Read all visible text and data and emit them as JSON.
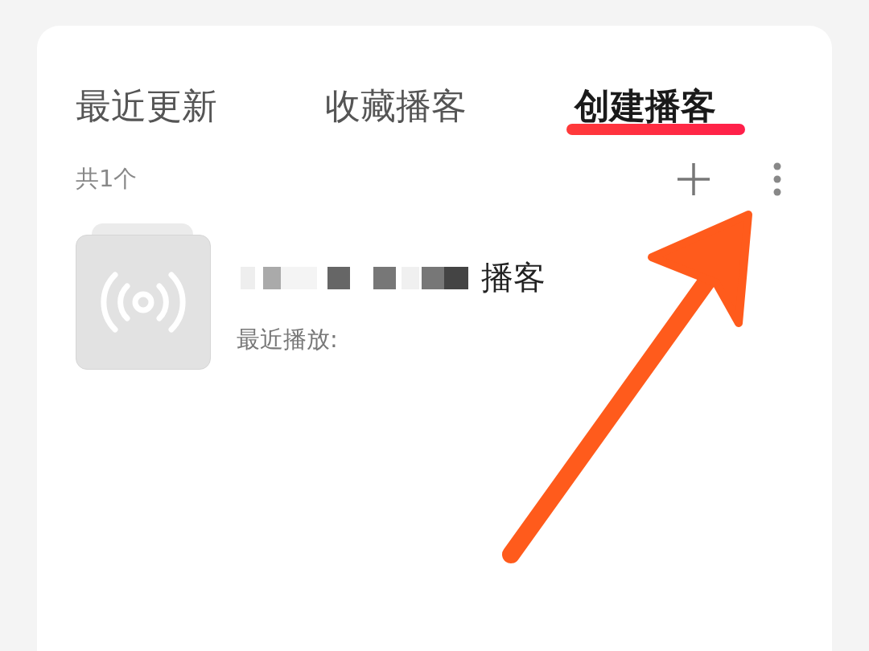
{
  "tabs": [
    {
      "label": "最近更新",
      "selected": false
    },
    {
      "label": "收藏播客",
      "selected": false
    },
    {
      "label": "创建播客",
      "selected": true
    }
  ],
  "toolbar": {
    "count": "共1个"
  },
  "podcasts": [
    {
      "title": "播客",
      "subtitle": "最近播放:"
    }
  ]
}
